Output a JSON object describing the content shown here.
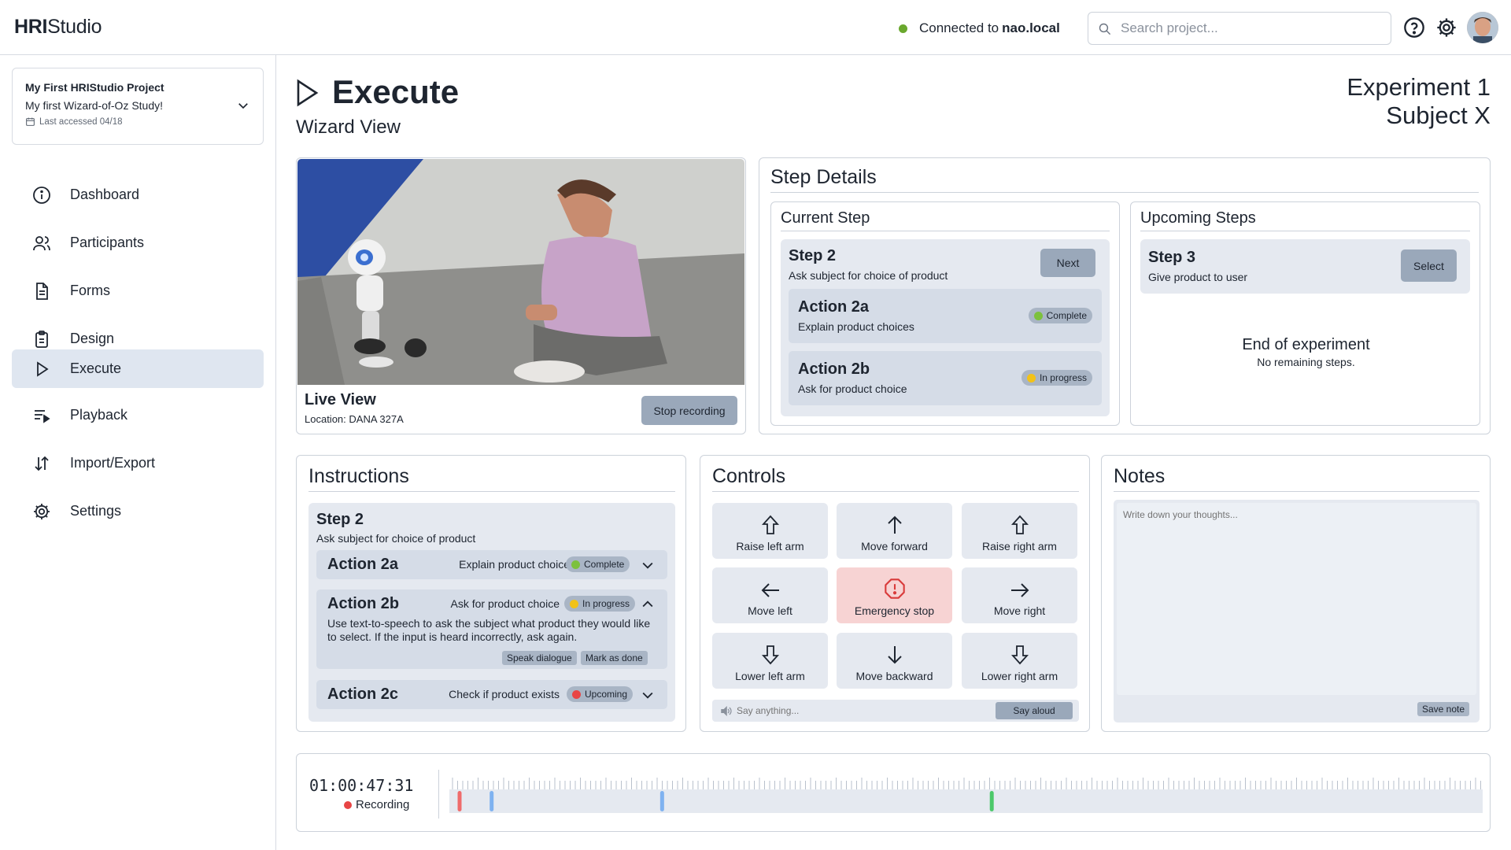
{
  "app": {
    "logo_bold": "HRI",
    "logo_rest": "Studio"
  },
  "header": {
    "connection_prefix": "Connected to",
    "connection_host": "nao.local",
    "search_placeholder": "Search project...",
    "connection_color": "#6aa82e"
  },
  "sidebar": {
    "project": {
      "name": "My First HRIStudio Project",
      "description": "My first Wizard-of-Oz Study!",
      "last_accessed": "Last accessed 04/18"
    },
    "items": [
      {
        "label": "Dashboard",
        "icon": "info-circle-icon"
      },
      {
        "label": "Participants",
        "icon": "users-icon"
      },
      {
        "label": "Forms",
        "icon": "document-icon"
      },
      {
        "label": "Design",
        "icon": "clipboard-icon"
      },
      {
        "label": "Execute",
        "icon": "play-icon",
        "active": true
      },
      {
        "label": "Playback",
        "icon": "playlist-icon"
      },
      {
        "label": "Import/Export",
        "icon": "arrows-updown-icon"
      },
      {
        "label": "Settings",
        "icon": "gear-icon"
      }
    ]
  },
  "page": {
    "title": "Execute",
    "subtitle": "Wizard View",
    "experiment": "Experiment 1",
    "subject": "Subject X"
  },
  "live": {
    "title": "Live View",
    "location_label": "Location:",
    "location": "DANA 327A",
    "stop_label": "Stop recording"
  },
  "step_details": {
    "title": "Step Details",
    "current_title": "Current Step",
    "current_step": {
      "name": "Step 2",
      "desc": "Ask subject for choice of product",
      "next_label": "Next"
    },
    "actions": [
      {
        "name": "Action 2a",
        "desc": "Explain product choices",
        "status": "Complete",
        "status_color": "#7cc13d"
      },
      {
        "name": "Action 2b",
        "desc": "Ask for product choice",
        "status": "In progress",
        "status_color": "#f2c218"
      }
    ],
    "upcoming_title": "Upcoming Steps",
    "upcoming_step": {
      "name": "Step 3",
      "desc": "Give product to user",
      "select_label": "Select"
    },
    "end_title": "End of experiment",
    "end_desc": "No remaining steps."
  },
  "instructions": {
    "title": "Instructions",
    "step_name": "Step 2",
    "step_desc": "Ask subject for choice of product",
    "actions": [
      {
        "name": "Action 2a",
        "desc": "Explain product choices",
        "status": "Complete",
        "status_color": "#7cc13d"
      },
      {
        "name": "Action 2b",
        "desc": "Ask for product choice",
        "status": "In progress",
        "status_color": "#f2c218",
        "detail": "Use text-to-speech to ask the subject what product they would like to select. If the input is heard incorrectly, ask again.",
        "speak_label": "Speak dialogue",
        "done_label": "Mark as done"
      },
      {
        "name": "Action 2c",
        "desc": "Check if product exists",
        "status": "Upcoming",
        "status_color": "#e84545"
      }
    ]
  },
  "controls": {
    "title": "Controls",
    "buttons": [
      "Raise left arm",
      "Move forward",
      "Raise right arm",
      "Move left",
      "Emergency stop",
      "Move right",
      "Lower left arm",
      "Move backward",
      "Lower right arm"
    ],
    "say_placeholder": "Say anything...",
    "say_label": "Say aloud",
    "emergency_color": "#f7d3d3"
  },
  "notes": {
    "title": "Notes",
    "placeholder": "Write down your thoughts...",
    "save_label": "Save note"
  },
  "timeline": {
    "time": "01:00:47:31",
    "status": "Recording",
    "markers": [
      {
        "pos": 0.008,
        "color": "#ef6b6b"
      },
      {
        "pos": 0.039,
        "color": "#7fb2f0"
      },
      {
        "pos": 0.204,
        "color": "#7fb2f0"
      },
      {
        "pos": 0.523,
        "color": "#4cc86a"
      }
    ]
  }
}
